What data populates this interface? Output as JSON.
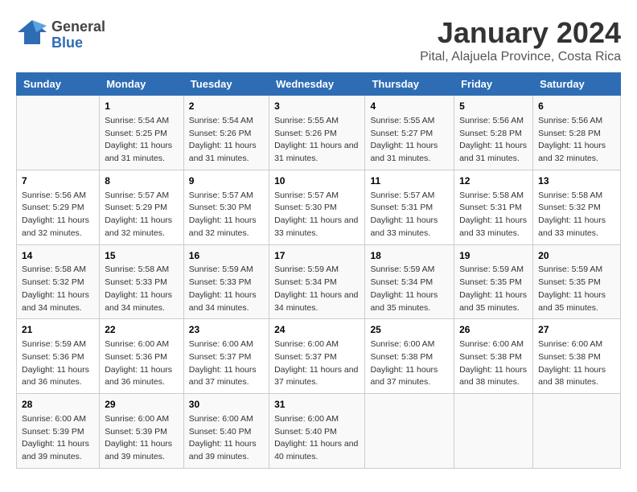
{
  "header": {
    "logo_general": "General",
    "logo_blue": "Blue",
    "title": "January 2024",
    "subtitle": "Pital, Alajuela Province, Costa Rica"
  },
  "columns": [
    "Sunday",
    "Monday",
    "Tuesday",
    "Wednesday",
    "Thursday",
    "Friday",
    "Saturday"
  ],
  "weeks": [
    [
      {
        "day": "",
        "sunrise": "",
        "sunset": "",
        "daylight": ""
      },
      {
        "day": "1",
        "sunrise": "Sunrise: 5:54 AM",
        "sunset": "Sunset: 5:25 PM",
        "daylight": "Daylight: 11 hours and 31 minutes."
      },
      {
        "day": "2",
        "sunrise": "Sunrise: 5:54 AM",
        "sunset": "Sunset: 5:26 PM",
        "daylight": "Daylight: 11 hours and 31 minutes."
      },
      {
        "day": "3",
        "sunrise": "Sunrise: 5:55 AM",
        "sunset": "Sunset: 5:26 PM",
        "daylight": "Daylight: 11 hours and 31 minutes."
      },
      {
        "day": "4",
        "sunrise": "Sunrise: 5:55 AM",
        "sunset": "Sunset: 5:27 PM",
        "daylight": "Daylight: 11 hours and 31 minutes."
      },
      {
        "day": "5",
        "sunrise": "Sunrise: 5:56 AM",
        "sunset": "Sunset: 5:28 PM",
        "daylight": "Daylight: 11 hours and 31 minutes."
      },
      {
        "day": "6",
        "sunrise": "Sunrise: 5:56 AM",
        "sunset": "Sunset: 5:28 PM",
        "daylight": "Daylight: 11 hours and 32 minutes."
      }
    ],
    [
      {
        "day": "7",
        "sunrise": "Sunrise: 5:56 AM",
        "sunset": "Sunset: 5:29 PM",
        "daylight": "Daylight: 11 hours and 32 minutes."
      },
      {
        "day": "8",
        "sunrise": "Sunrise: 5:57 AM",
        "sunset": "Sunset: 5:29 PM",
        "daylight": "Daylight: 11 hours and 32 minutes."
      },
      {
        "day": "9",
        "sunrise": "Sunrise: 5:57 AM",
        "sunset": "Sunset: 5:30 PM",
        "daylight": "Daylight: 11 hours and 32 minutes."
      },
      {
        "day": "10",
        "sunrise": "Sunrise: 5:57 AM",
        "sunset": "Sunset: 5:30 PM",
        "daylight": "Daylight: 11 hours and 33 minutes."
      },
      {
        "day": "11",
        "sunrise": "Sunrise: 5:57 AM",
        "sunset": "Sunset: 5:31 PM",
        "daylight": "Daylight: 11 hours and 33 minutes."
      },
      {
        "day": "12",
        "sunrise": "Sunrise: 5:58 AM",
        "sunset": "Sunset: 5:31 PM",
        "daylight": "Daylight: 11 hours and 33 minutes."
      },
      {
        "day": "13",
        "sunrise": "Sunrise: 5:58 AM",
        "sunset": "Sunset: 5:32 PM",
        "daylight": "Daylight: 11 hours and 33 minutes."
      }
    ],
    [
      {
        "day": "14",
        "sunrise": "Sunrise: 5:58 AM",
        "sunset": "Sunset: 5:32 PM",
        "daylight": "Daylight: 11 hours and 34 minutes."
      },
      {
        "day": "15",
        "sunrise": "Sunrise: 5:58 AM",
        "sunset": "Sunset: 5:33 PM",
        "daylight": "Daylight: 11 hours and 34 minutes."
      },
      {
        "day": "16",
        "sunrise": "Sunrise: 5:59 AM",
        "sunset": "Sunset: 5:33 PM",
        "daylight": "Daylight: 11 hours and 34 minutes."
      },
      {
        "day": "17",
        "sunrise": "Sunrise: 5:59 AM",
        "sunset": "Sunset: 5:34 PM",
        "daylight": "Daylight: 11 hours and 34 minutes."
      },
      {
        "day": "18",
        "sunrise": "Sunrise: 5:59 AM",
        "sunset": "Sunset: 5:34 PM",
        "daylight": "Daylight: 11 hours and 35 minutes."
      },
      {
        "day": "19",
        "sunrise": "Sunrise: 5:59 AM",
        "sunset": "Sunset: 5:35 PM",
        "daylight": "Daylight: 11 hours and 35 minutes."
      },
      {
        "day": "20",
        "sunrise": "Sunrise: 5:59 AM",
        "sunset": "Sunset: 5:35 PM",
        "daylight": "Daylight: 11 hours and 35 minutes."
      }
    ],
    [
      {
        "day": "21",
        "sunrise": "Sunrise: 5:59 AM",
        "sunset": "Sunset: 5:36 PM",
        "daylight": "Daylight: 11 hours and 36 minutes."
      },
      {
        "day": "22",
        "sunrise": "Sunrise: 6:00 AM",
        "sunset": "Sunset: 5:36 PM",
        "daylight": "Daylight: 11 hours and 36 minutes."
      },
      {
        "day": "23",
        "sunrise": "Sunrise: 6:00 AM",
        "sunset": "Sunset: 5:37 PM",
        "daylight": "Daylight: 11 hours and 37 minutes."
      },
      {
        "day": "24",
        "sunrise": "Sunrise: 6:00 AM",
        "sunset": "Sunset: 5:37 PM",
        "daylight": "Daylight: 11 hours and 37 minutes."
      },
      {
        "day": "25",
        "sunrise": "Sunrise: 6:00 AM",
        "sunset": "Sunset: 5:38 PM",
        "daylight": "Daylight: 11 hours and 37 minutes."
      },
      {
        "day": "26",
        "sunrise": "Sunrise: 6:00 AM",
        "sunset": "Sunset: 5:38 PM",
        "daylight": "Daylight: 11 hours and 38 minutes."
      },
      {
        "day": "27",
        "sunrise": "Sunrise: 6:00 AM",
        "sunset": "Sunset: 5:38 PM",
        "daylight": "Daylight: 11 hours and 38 minutes."
      }
    ],
    [
      {
        "day": "28",
        "sunrise": "Sunrise: 6:00 AM",
        "sunset": "Sunset: 5:39 PM",
        "daylight": "Daylight: 11 hours and 39 minutes."
      },
      {
        "day": "29",
        "sunrise": "Sunrise: 6:00 AM",
        "sunset": "Sunset: 5:39 PM",
        "daylight": "Daylight: 11 hours and 39 minutes."
      },
      {
        "day": "30",
        "sunrise": "Sunrise: 6:00 AM",
        "sunset": "Sunset: 5:40 PM",
        "daylight": "Daylight: 11 hours and 39 minutes."
      },
      {
        "day": "31",
        "sunrise": "Sunrise: 6:00 AM",
        "sunset": "Sunset: 5:40 PM",
        "daylight": "Daylight: 11 hours and 40 minutes."
      },
      {
        "day": "",
        "sunrise": "",
        "sunset": "",
        "daylight": ""
      },
      {
        "day": "",
        "sunrise": "",
        "sunset": "",
        "daylight": ""
      },
      {
        "day": "",
        "sunrise": "",
        "sunset": "",
        "daylight": ""
      }
    ]
  ]
}
